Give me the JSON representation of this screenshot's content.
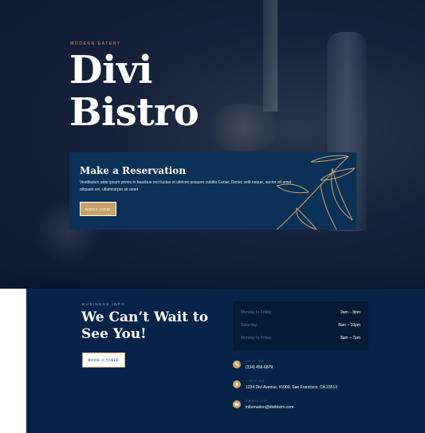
{
  "hero": {
    "eyebrow": "MODERN EATERY",
    "title_line1": "Divi",
    "title_line2": "Bistro"
  },
  "reservation": {
    "title": "Make a Reservation",
    "text": "Vestibulum ante ipsum primis in faucibus orci luctus et ultrices posuere cubilia Curae; Donec velit neque, auctor sit amet aliquam vel, ullamcorper sit amet",
    "button_label": "BOOK NOW"
  },
  "info": {
    "eyebrow": "BUSINESS INFO",
    "title_line1": "We Can’t Wait to",
    "title_line2": "See You!",
    "button_label": "BOOK A TABLE",
    "hours": [
      {
        "day": "Monday to Friday",
        "time": "9am – 8pm"
      },
      {
        "day": "Saturday",
        "time": "8am – 10pm"
      },
      {
        "day": "Monday to Friday",
        "time": "8am – 7pm"
      }
    ],
    "contacts": [
      {
        "icon": "phone-icon",
        "label": "CALL US",
        "value": "(334) 456-6879"
      },
      {
        "icon": "location-icon",
        "label": "VISIT US",
        "value": "1234 Divi Avenue, #1000, San Francisco, CA 23513"
      },
      {
        "icon": "email-icon",
        "label": "EMAIL US",
        "value": "information@divibistro.com"
      }
    ]
  },
  "colors": {
    "accent_gold": "#c9a26b",
    "navy": "#072448",
    "panel_blue": "#0b3157"
  }
}
